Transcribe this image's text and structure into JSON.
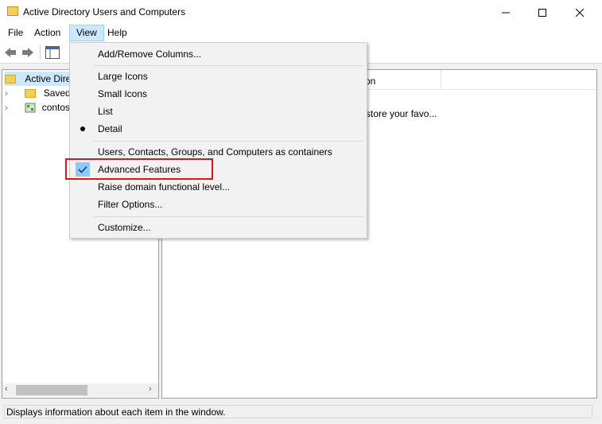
{
  "window": {
    "title": "Active Directory Users and Computers"
  },
  "menubar": {
    "file": "File",
    "action": "Action",
    "view": "View",
    "help": "Help"
  },
  "tree": {
    "root": "Active Directo",
    "saved": "Saved Q",
    "domain": "contoso"
  },
  "right_pane": {
    "column_description": "on",
    "row_text": "store your favo..."
  },
  "view_menu": {
    "items": [
      {
        "label": "Add/Remove Columns..."
      },
      {
        "label": "Large Icons"
      },
      {
        "label": "Small Icons"
      },
      {
        "label": "List"
      },
      {
        "label": "Detail",
        "selected": true
      },
      {
        "label": "Users, Contacts, Groups, and Computers as containers"
      },
      {
        "label": "Advanced Features",
        "checked": true
      },
      {
        "label": "Raise domain functional level..."
      },
      {
        "label": "Filter Options..."
      },
      {
        "label": "Customize..."
      }
    ]
  },
  "statusbar": {
    "text": "Displays information about each item in the window."
  },
  "colors": {
    "highlight_box": "#e0141a",
    "menu_open_bg": "#cce8ff",
    "check_bg": "#90c8f6"
  }
}
